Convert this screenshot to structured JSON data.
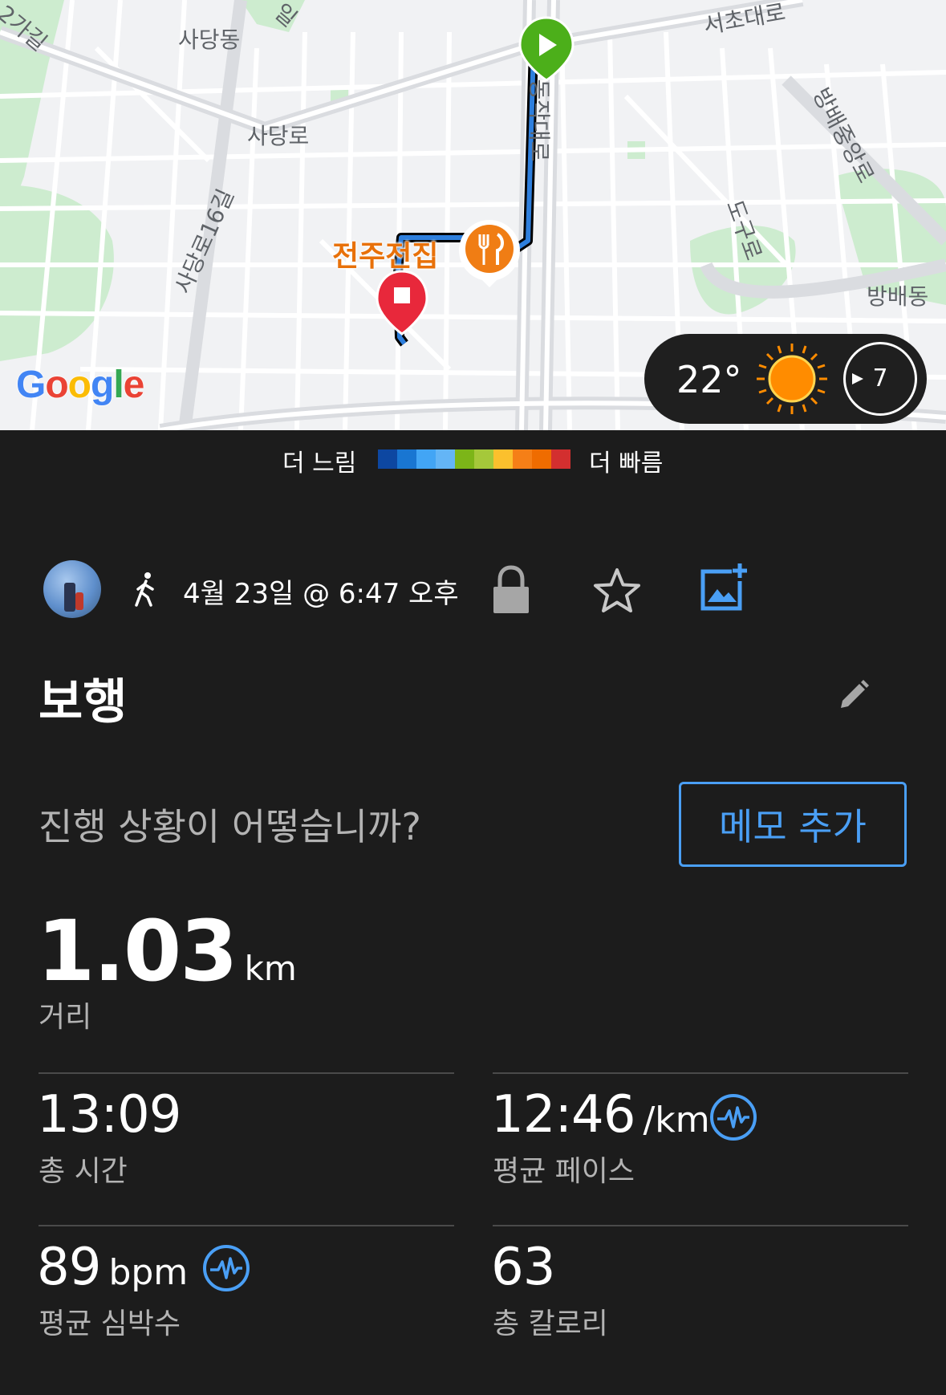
{
  "map": {
    "labels": {
      "sadang_dong": "사당동",
      "sadang_ro": "사당로",
      "sadang_ro_16": "사당로16길",
      "ga_gil": "2가길",
      "seocho": "서초대로",
      "dongjak": "동작대로",
      "bangbae_jungang": "방배중앙로",
      "dogu_ro": "도구로",
      "bangbae_dong": "방배동",
      "top_road": "일"
    },
    "poi_label": "전주전집",
    "google_logo": "Google",
    "weather": {
      "temperature": "22°",
      "wind_value": "7",
      "icon": "sun-icon"
    }
  },
  "legend": {
    "slow_label": "더 느림",
    "fast_label": "더 빠름",
    "colors": [
      "#0d47a1",
      "#1976d2",
      "#42a5f5",
      "#64b5f6",
      "#7cb518",
      "#a5c83a",
      "#fbc02d",
      "#f57f17",
      "#ef6c00",
      "#d32f2f"
    ]
  },
  "activity": {
    "date": "4월 23일 @ 6:47 오후",
    "title": "보행",
    "prompt": "진행 상황이 어떻습니까?",
    "memo_button": "메모 추가",
    "distance": {
      "value": "1.03",
      "unit": "km",
      "label": "거리"
    },
    "stats": {
      "total_time": {
        "value": "13:09",
        "label": "총 시간"
      },
      "avg_pace": {
        "value": "12:46",
        "unit": "/km",
        "label": "평균 페이스"
      },
      "avg_hr": {
        "value": "89",
        "unit": "bpm",
        "label": "평균 심박수"
      },
      "calories": {
        "value": "63",
        "label": "총 칼로리"
      }
    }
  },
  "colors": {
    "accent": "#4a9ff5",
    "background": "#1c1c1c",
    "start_marker": "#4caf1a",
    "end_marker": "#e8283b",
    "poi": "#f07d14"
  }
}
